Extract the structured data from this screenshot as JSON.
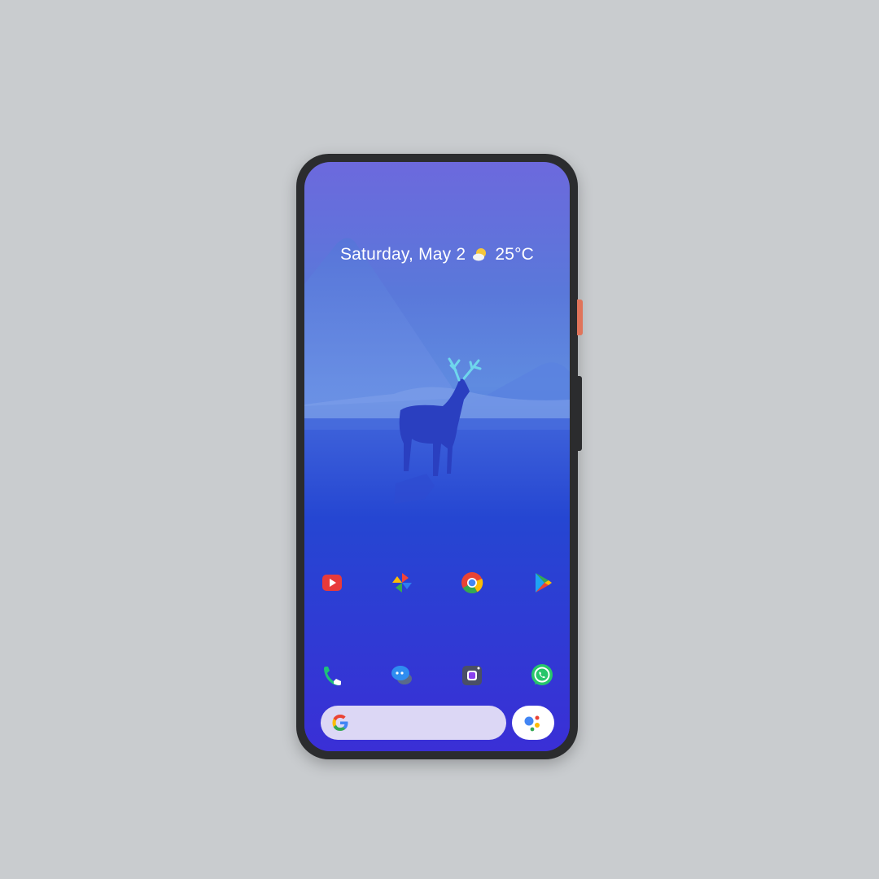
{
  "status": {
    "date": "Saturday, May 2",
    "temperature": "25°C",
    "weather_icon": "partly-sunny-icon"
  },
  "home_row_apps": [
    {
      "name": "YouTube",
      "icon": "youtube-icon"
    },
    {
      "name": "Pinwheel",
      "icon": "pinwheel-icon"
    },
    {
      "name": "Chrome",
      "icon": "chrome-icon"
    },
    {
      "name": "Play Store",
      "icon": "play-store-icon"
    }
  ],
  "dock_apps": [
    {
      "name": "Phone",
      "icon": "phone-icon"
    },
    {
      "name": "Messages",
      "icon": "messages-icon"
    },
    {
      "name": "Camera",
      "icon": "camera-icon"
    },
    {
      "name": "WhatsApp",
      "icon": "whatsapp-icon"
    }
  ],
  "search": {
    "icon": "google-g-icon",
    "assistant_icon": "assistant-icon"
  },
  "colors": {
    "background": "#c9cccf",
    "phone_frame": "#2b2c2e",
    "power_button": "#e0745a",
    "search_bar": "#dcd7f5"
  }
}
